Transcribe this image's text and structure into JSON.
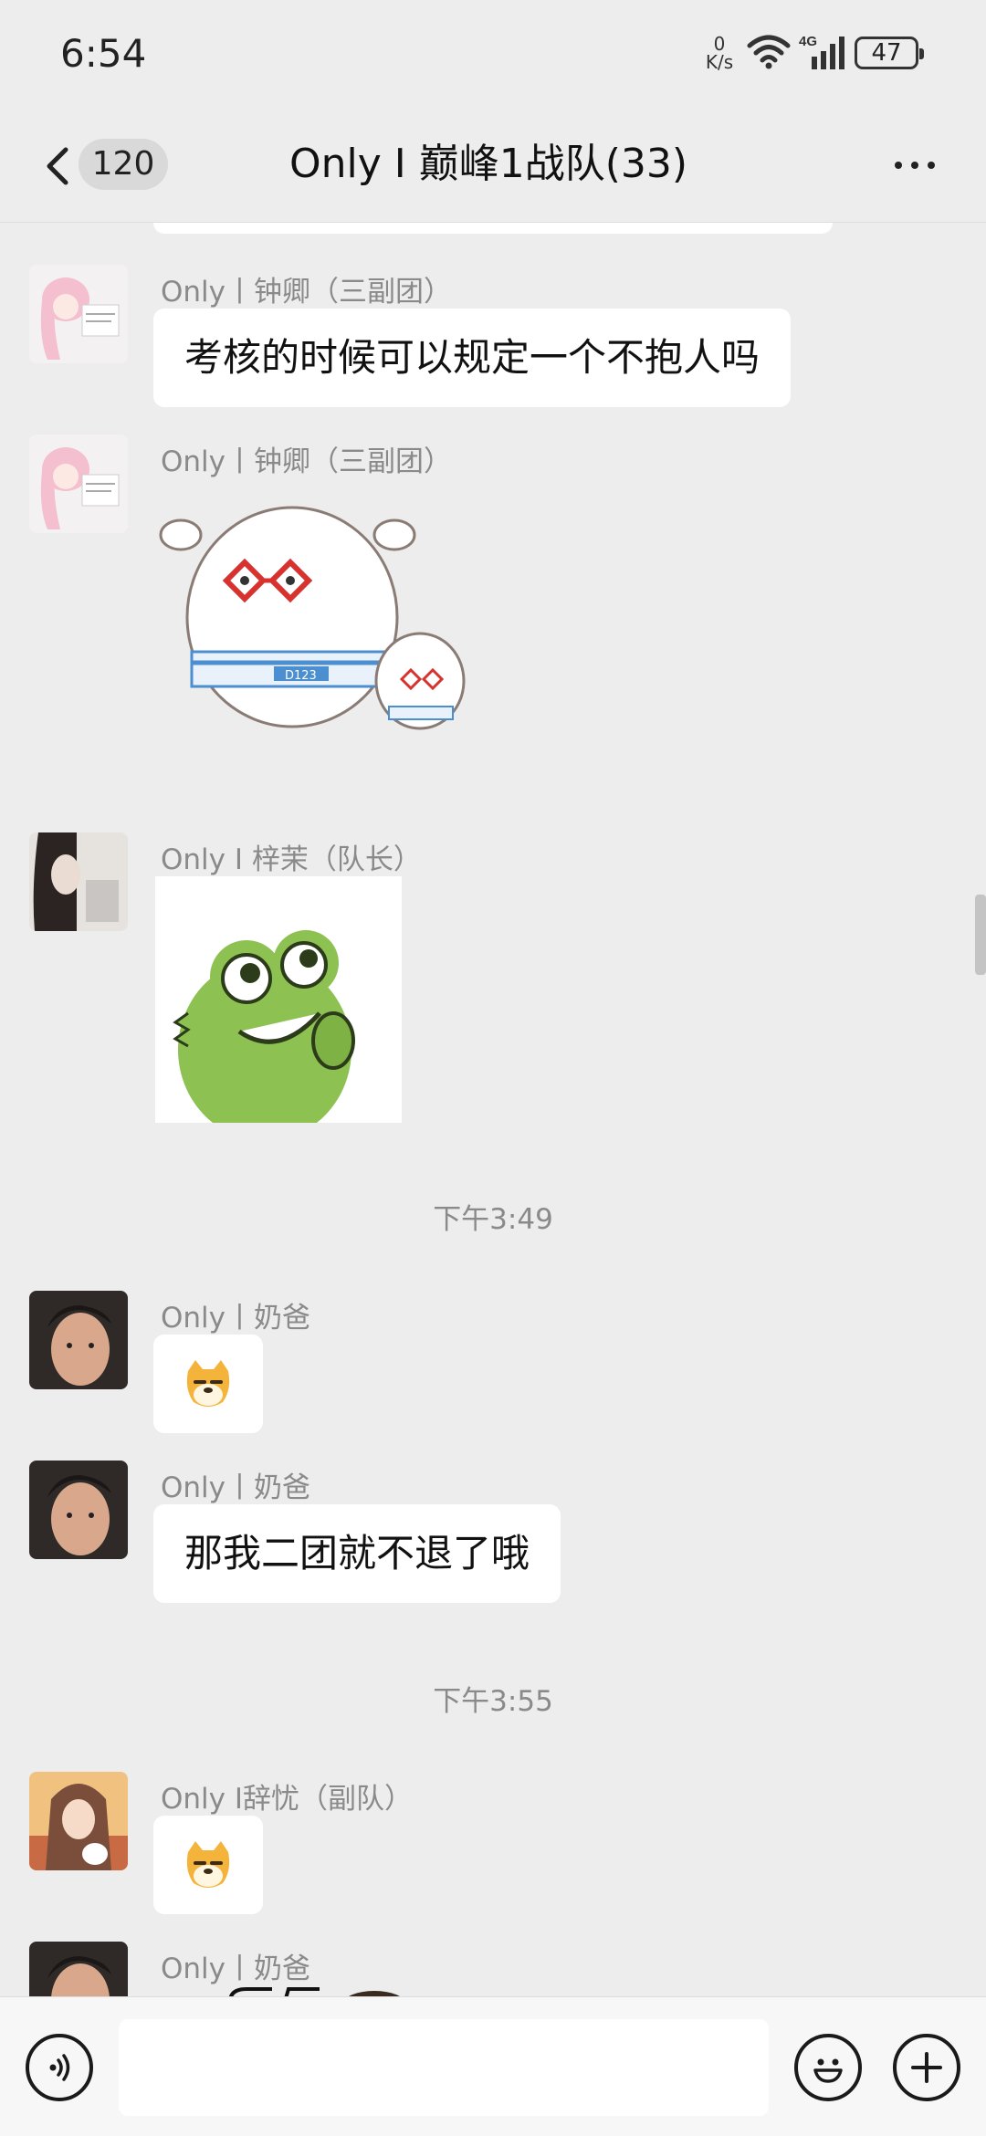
{
  "status_bar": {
    "time": "6:54",
    "net_speed_value": "0",
    "net_speed_unit": "K/s",
    "network_type": "4G",
    "battery": "47",
    "icons": [
      "wifi-icon",
      "signal-icon",
      "battery-icon"
    ]
  },
  "header": {
    "unread_count": "120",
    "title": "Only I 巅峰1战队(33)",
    "icons": [
      "back-arrow-icon",
      "more-icon"
    ]
  },
  "messages": [
    {
      "sender": "Only丨钟卿（三副团）",
      "type": "text",
      "text": "考核的时候可以规定一个不抱人吗"
    },
    {
      "sender": "Only丨钟卿（三副团）",
      "type": "sticker",
      "sticker": "white-sheep-with-red-glasses-sticker",
      "sticker_text": "D123"
    },
    {
      "sender": "Only I 梓茉（队长）",
      "type": "sticker",
      "sticker": "green-frog-sticker"
    },
    {
      "type": "timestamp",
      "text": "下午3:49"
    },
    {
      "sender": "Only丨奶爸",
      "type": "emoji",
      "emoji": "doge-emoji"
    },
    {
      "sender": "Only丨奶爸",
      "type": "text",
      "text": "那我二团就不退了哦"
    },
    {
      "type": "timestamp",
      "text": "下午3:55"
    },
    {
      "sender": "Only I辞忧（副队）",
      "type": "emoji",
      "emoji": "doge-emoji"
    },
    {
      "sender": "Only丨奶爸",
      "type": "partial"
    }
  ],
  "input_bar": {
    "placeholder": "",
    "icons": [
      "voice-icon",
      "emoji-face-icon",
      "plus-icon"
    ]
  },
  "colors": {
    "background": "#ededed",
    "bubble": "#ffffff",
    "secondary_text": "#8a8a8a",
    "sticker_red": "#d8322f",
    "sticker_blue": "#4c8fd0",
    "frog_green": "#8dc152",
    "doge_yellow": "#f4b43c"
  }
}
